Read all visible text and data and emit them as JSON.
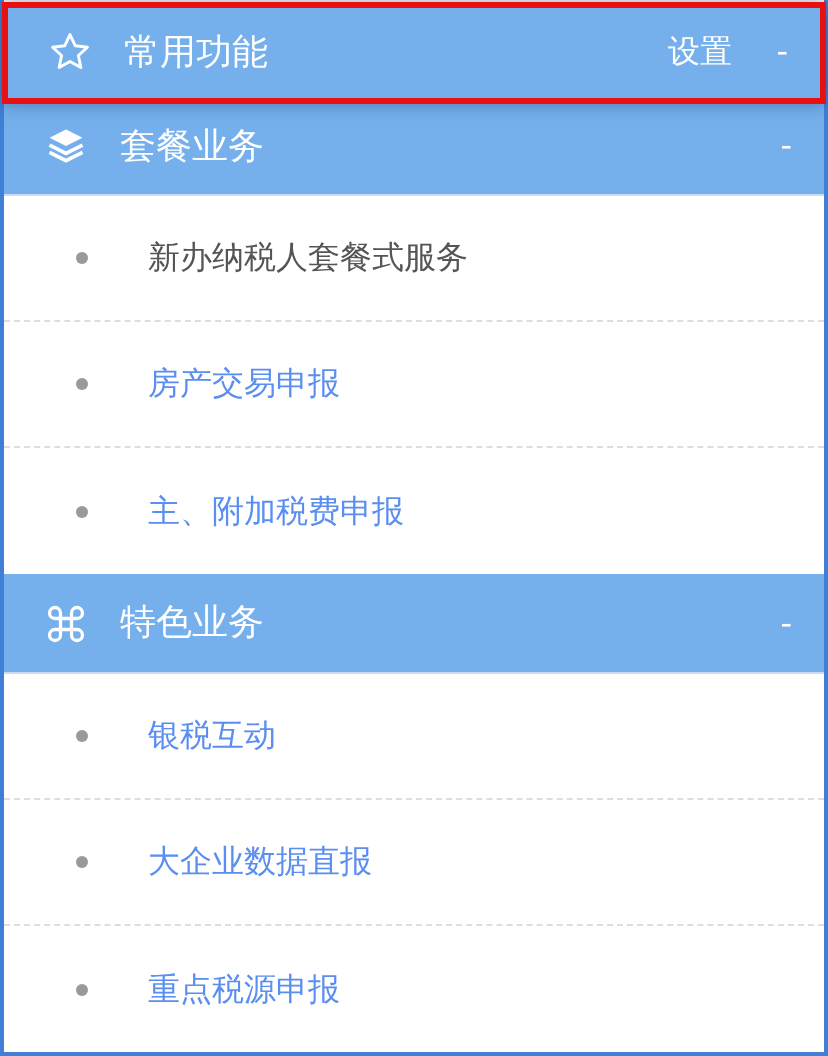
{
  "sections": [
    {
      "kind": "star",
      "title": "常用功能",
      "action": "设置",
      "toggle": "-",
      "highlighted": true
    },
    {
      "kind": "layers",
      "title": "套餐业务",
      "toggle": "-",
      "highlighted": false,
      "items": [
        {
          "label": "新办纳税人套餐式服务",
          "selected": true
        },
        {
          "label": "房产交易申报",
          "selected": false
        },
        {
          "label": "主、附加税费申报",
          "selected": false
        }
      ]
    },
    {
      "kind": "command",
      "title": "特色业务",
      "toggle": "-",
      "highlighted": false,
      "items": [
        {
          "label": "银税互动",
          "selected": false
        },
        {
          "label": "大企业数据直报",
          "selected": false
        },
        {
          "label": "重点税源申报",
          "selected": false
        }
      ]
    }
  ]
}
